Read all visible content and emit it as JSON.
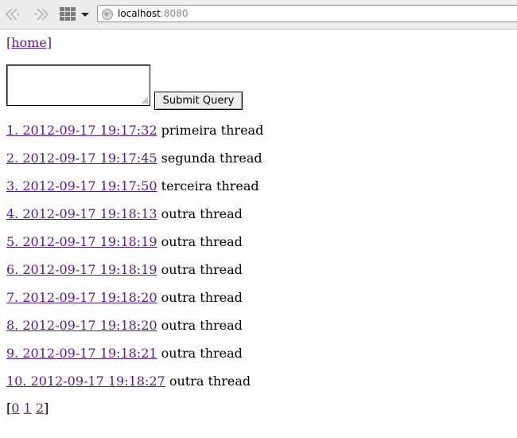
{
  "browser": {
    "url_host": "localhost",
    "url_port": ":8080",
    "icons": [
      "back-icon",
      "forward-icon",
      "grid-icon",
      "chevron-down-icon",
      "globe-icon"
    ]
  },
  "page": {
    "home_link": "[home]",
    "submit_label": "Submit Query",
    "textarea_value": "",
    "threads": [
      {
        "link": "1. 2012-09-17 19:17:32",
        "title": "primeira thread"
      },
      {
        "link": "2. 2012-09-17 19:17:45",
        "title": "segunda thread"
      },
      {
        "link": "3. 2012-09-17 19:17:50",
        "title": "terceira thread"
      },
      {
        "link": "4. 2012-09-17 19:18:13",
        "title": "outra thread"
      },
      {
        "link": "5. 2012-09-17 19:18:19",
        "title": "outra thread"
      },
      {
        "link": "6. 2012-09-17 19:18:19",
        "title": "outra thread"
      },
      {
        "link": "7. 2012-09-17 19:18:20",
        "title": "outra thread"
      },
      {
        "link": "8. 2012-09-17 19:18:20",
        "title": "outra thread"
      },
      {
        "link": "9. 2012-09-17 19:18:21",
        "title": "outra thread"
      },
      {
        "link": "10. 2012-09-17 19:18:27",
        "title": "outra thread"
      }
    ],
    "pager": {
      "open": "[",
      "pages": [
        "0",
        "1",
        "2"
      ],
      "close": "]"
    },
    "colors": {
      "link": "#551a8b",
      "toolbar": "#ededed"
    }
  }
}
